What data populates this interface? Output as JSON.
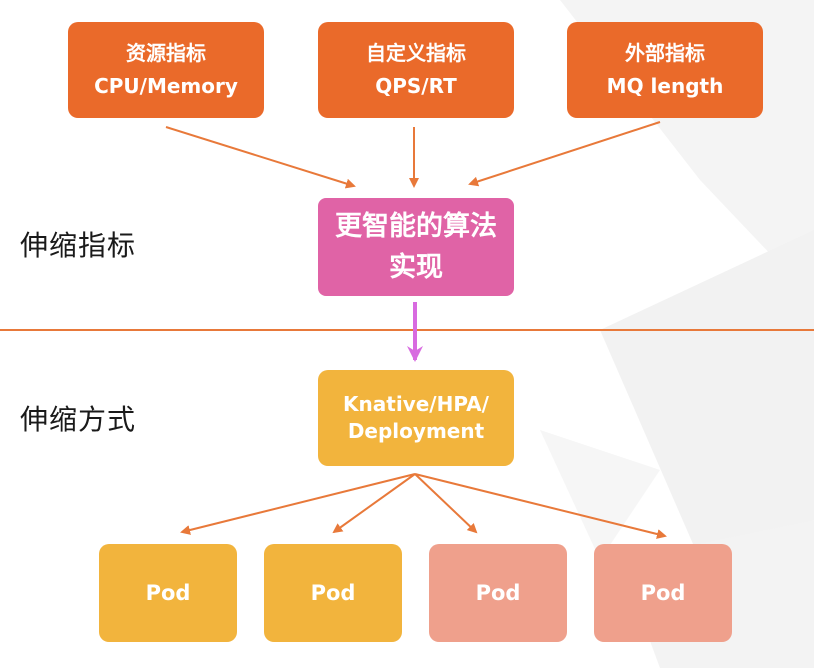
{
  "metrics": [
    {
      "line1": "资源指标",
      "line2": "CPU/Memory"
    },
    {
      "line1": "自定义指标",
      "line2": "QPS/RT"
    },
    {
      "line1": "外部指标",
      "line2": "MQ length"
    }
  ],
  "algorithm": {
    "line1": "更智能的算法",
    "line2": "实现"
  },
  "sections": {
    "metrics_label": "伸缩指标",
    "method_label": "伸缩方式"
  },
  "method": {
    "line1": "Knative/HPA/",
    "line2": "Deployment"
  },
  "pods": [
    {
      "label": "Pod"
    },
    {
      "label": "Pod"
    },
    {
      "label": "Pod"
    },
    {
      "label": "Pod"
    }
  ],
  "colors": {
    "metric_box": "#ea6a2a",
    "algorithm_box": "#e063a6",
    "method_box": "#f2b43d",
    "pod_active": "#f2b43d",
    "pod_pending": "#efa08c",
    "arrow": "#e8793a",
    "arrow_highlight": "#d86be0"
  }
}
